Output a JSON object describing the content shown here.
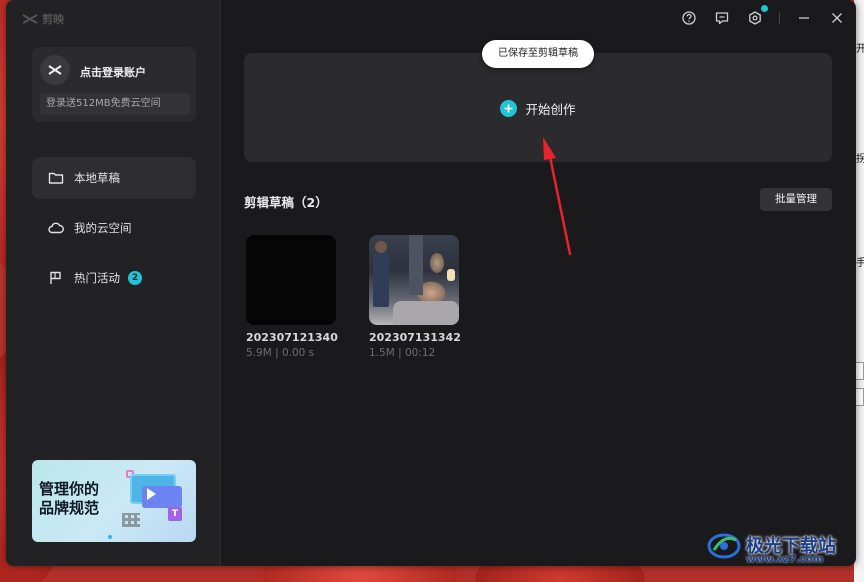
{
  "app": {
    "logo_text": "剪映"
  },
  "account": {
    "login_label": "点击登录账户",
    "cloud_offer": "登录送512MB免费云空间"
  },
  "sidebar": {
    "items": [
      {
        "label": "本地草稿",
        "active": true
      },
      {
        "label": "我的云空间",
        "active": false
      },
      {
        "label": "热门活动",
        "active": false,
        "badge": "2"
      }
    ]
  },
  "banner": {
    "title_line1": "管理你的",
    "title_line2": "品牌规范"
  },
  "toast": {
    "text": "已保存至剪辑草稿"
  },
  "create": {
    "label": "开始创作"
  },
  "drafts_section": {
    "title": "剪辑草稿（2）",
    "batch_label": "批量管理",
    "items": [
      {
        "name": "202307121340",
        "meta": "5.9M | 0.00 s"
      },
      {
        "name": "202307131342",
        "meta": "1.5M | 00:12"
      }
    ]
  },
  "watermark": {
    "text": "极光下载站",
    "url": "www.xz7.com"
  },
  "colors": {
    "accent": "#22c3d6",
    "window_bg": "#1a1a1c",
    "sidebar_bg": "#222224",
    "arrow": "#e8232b"
  }
}
